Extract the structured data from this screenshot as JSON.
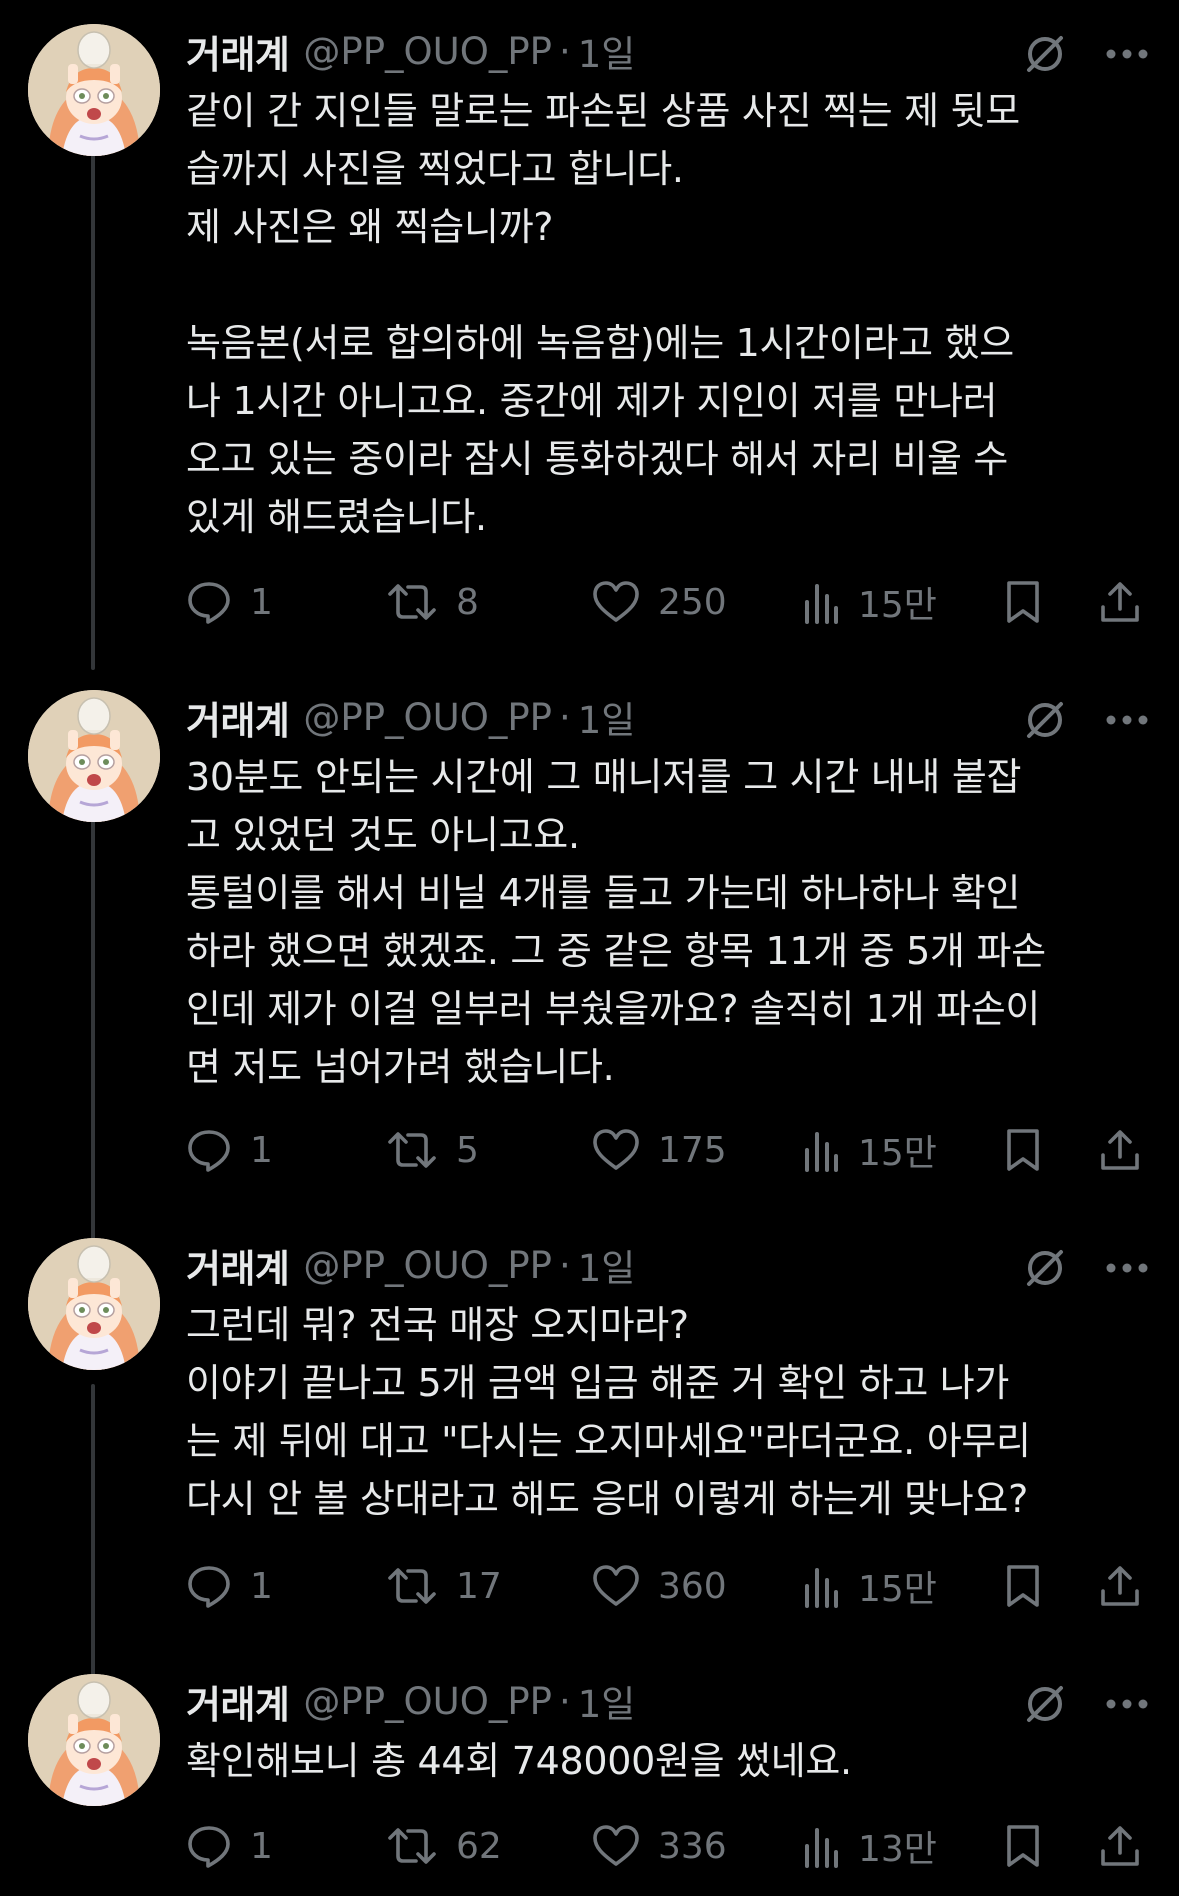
{
  "colors": {
    "background": "#000000",
    "text_primary": "#e7e9ea",
    "text_secondary": "#71767b",
    "thread_line": "#333639"
  },
  "tweets": [
    {
      "name": "거래계",
      "handle": "@PP_OUO_PP",
      "separator": "·",
      "time": "1일",
      "text": "같이 간 지인들 말로는 파손된 상품 사진 찍는 제 뒷모\n습까지 사진을 찍었다고 합니다.\n제 사진은 왜 찍습니까?\n\n녹음본(서로 합의하에 녹음함)에는 1시간이라고 했으\n나 1시간 아니고요. 중간에 제가 지인이 저를 만나러\n오고 있는 중이라 잠시 통화하겠다 해서 자리 비울 수\n있게 해드렸습니다.",
      "replies": "1",
      "retweets": "8",
      "likes": "250",
      "views": "15만"
    },
    {
      "name": "거래계",
      "handle": "@PP_OUO_PP",
      "separator": "·",
      "time": "1일",
      "text": "30분도 안되는 시간에 그 매니저를 그 시간 내내 붙잡\n고 있었던 것도 아니고요.\n통털이를 해서 비닐 4개를 들고 가는데 하나하나 확인\n하라 했으면 했겠죠. 그 중 같은 항목 11개 중 5개 파손\n인데 제가 이걸 일부러 부쉈을까요? 솔직히 1개 파손이\n면 저도 넘어가려 했습니다.",
      "replies": "1",
      "retweets": "5",
      "likes": "175",
      "views": "15만"
    },
    {
      "name": "거래계",
      "handle": "@PP_OUO_PP",
      "separator": "·",
      "time": "1일",
      "text": "그런데 뭐? 전국 매장 오지마라?\n이야기 끝나고 5개 금액 입금 해준 거 확인 하고 나가\n는 제 뒤에 대고 \"다시는 오지마세요\"라더군요. 아무리\n다시 안 볼 상대라고 해도 응대 이렇게 하는게 맞나요?",
      "replies": "1",
      "retweets": "17",
      "likes": "360",
      "views": "15만"
    },
    {
      "name": "거래계",
      "handle": "@PP_OUO_PP",
      "separator": "·",
      "time": "1일",
      "text": "확인해보니 총 44회 748000원을 썼네요.",
      "replies": "1",
      "retweets": "62",
      "likes": "336",
      "views": "13만"
    }
  ],
  "icons": {
    "grok": "grok-icon",
    "more": "more-icon",
    "reply": "reply-icon",
    "retweet": "retweet-icon",
    "like": "heart-icon",
    "views": "views-icon",
    "bookmark": "bookmark-icon",
    "share": "share-icon"
  }
}
